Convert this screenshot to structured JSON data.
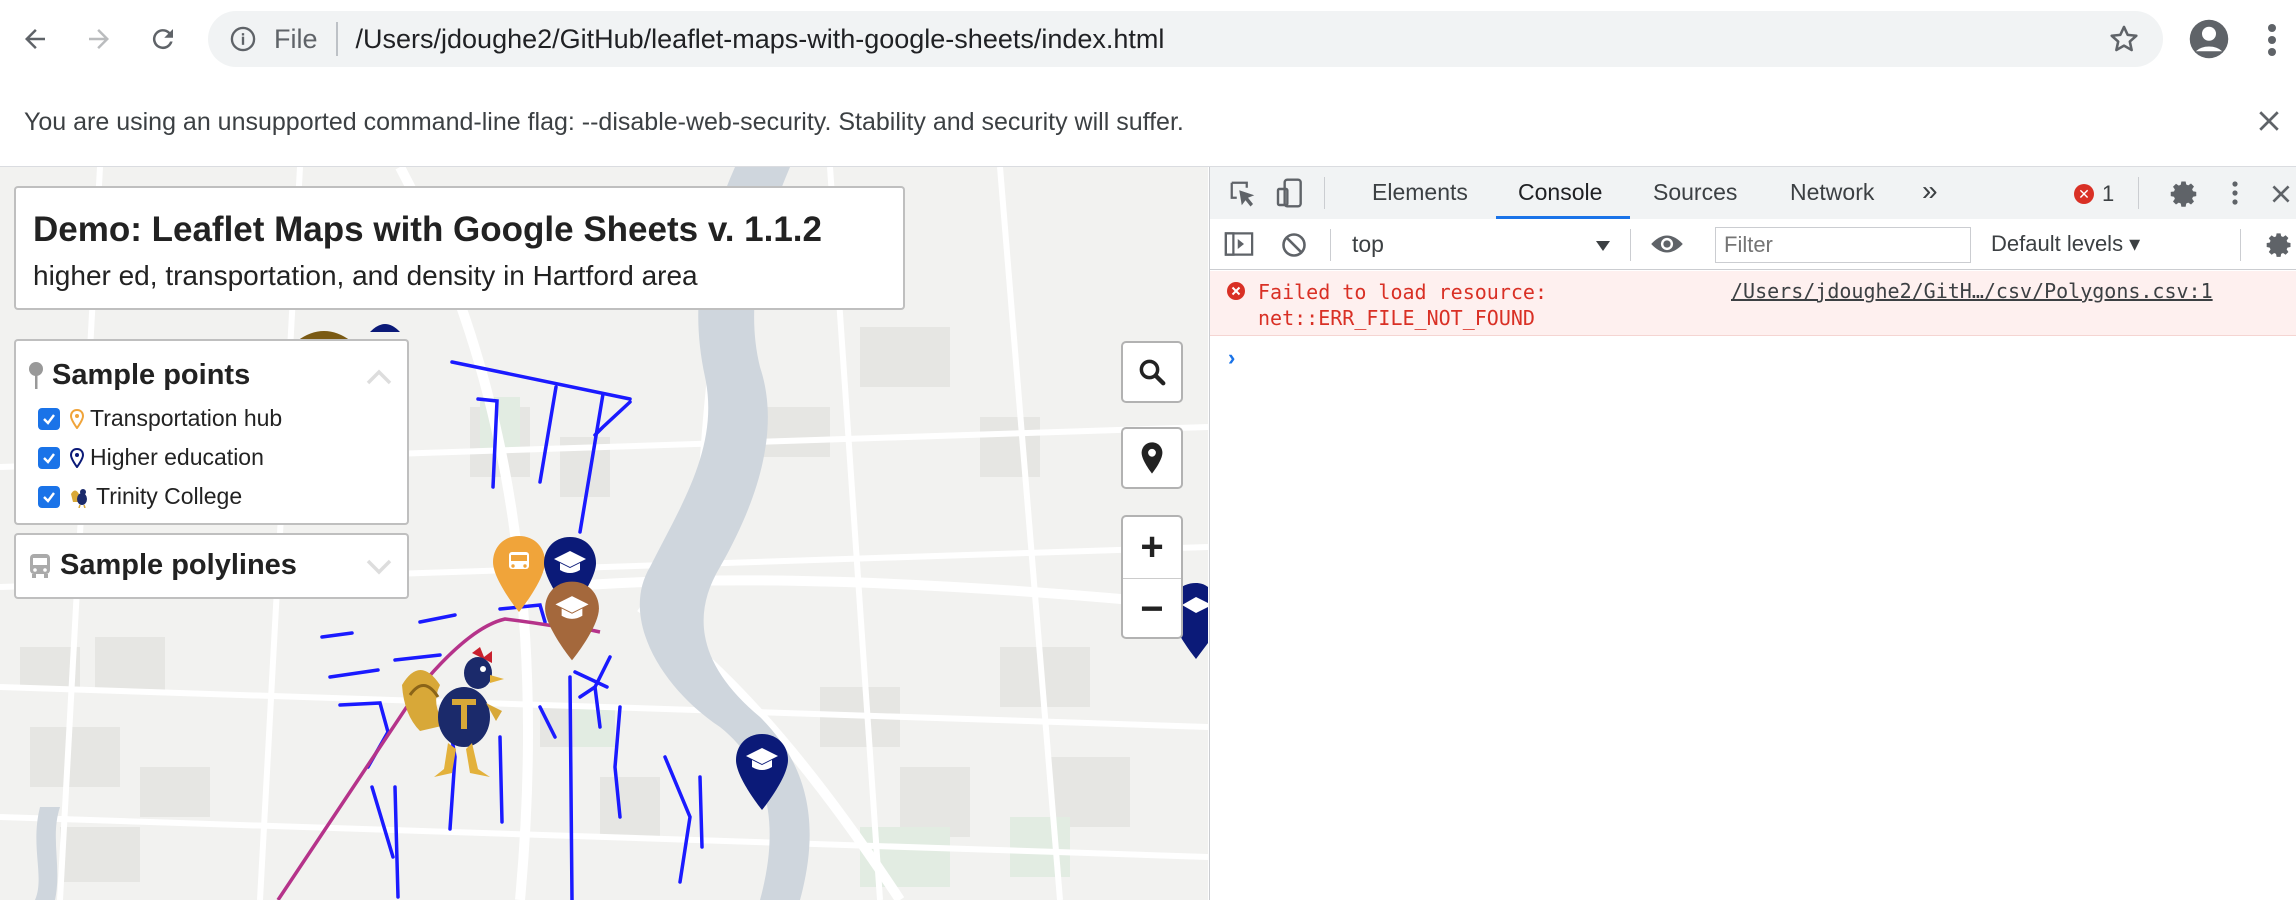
{
  "browser": {
    "scheme_label": "File",
    "url": "/Users/jdoughe2/GitHub/leaflet-maps-with-google-sheets/index.html"
  },
  "infobar": {
    "message": "You are using an unsupported command-line flag: --disable-web-security. Stability and security will suffer."
  },
  "map": {
    "title": "Demo: Leaflet Maps with Google Sheets v. 1.1.2",
    "subtitle": "higher ed, transportation, and density in Hartford area",
    "points_layer": {
      "label": "Sample points",
      "items": [
        {
          "label": "Transportation hub",
          "checked": true,
          "icon": "orange-marker-icon",
          "color": "#f0a43a"
        },
        {
          "label": "Higher education",
          "checked": true,
          "icon": "navy-marker-icon",
          "color": "#0b1a78"
        },
        {
          "label": "Trinity College",
          "checked": true,
          "icon": "rooster-mascot-icon",
          "color": "#c79a2e"
        }
      ]
    },
    "polylines_layer": {
      "label": "Sample polylines"
    },
    "controls": {
      "zoom_in": "+",
      "zoom_out": "−"
    },
    "colors": {
      "polyline_blue": "#1a1aff",
      "polyline_magenta": "#b5338a",
      "river": "#cfd6dd"
    }
  },
  "devtools": {
    "tabs": [
      "Elements",
      "Console",
      "Sources",
      "Network"
    ],
    "active_tab": "Console",
    "more_tabs": "»",
    "error_count": "1",
    "context": "top",
    "filter_placeholder": "Filter",
    "levels_label": "Default levels ▾",
    "console": {
      "error_line1": "Failed to load resource:",
      "error_line2": "net::ERR_FILE_NOT_FOUND",
      "error_source": "/Users/jdoughe2/GitH…/csv/Polygons.csv:1",
      "prompt": "›"
    }
  }
}
